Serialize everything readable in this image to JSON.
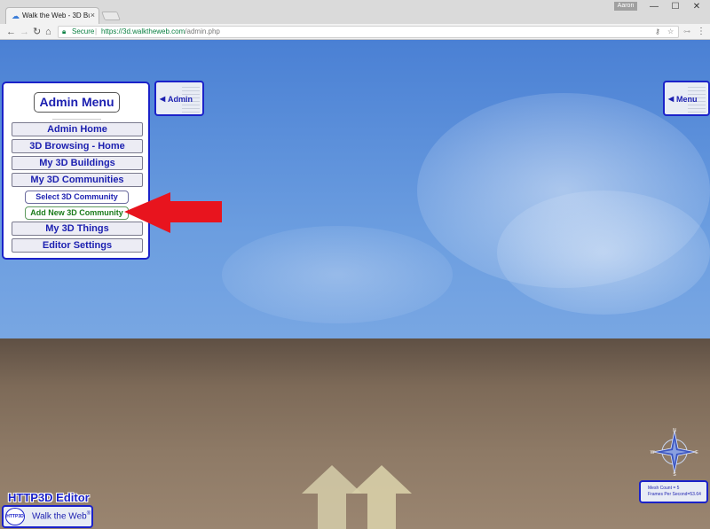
{
  "browser": {
    "tab_title": "Walk the Web - 3D Buildi",
    "tab_close": "×",
    "user_badge": "Aaron",
    "window": {
      "minimize": "—",
      "maximize": "☐",
      "close": "✕"
    },
    "nav": {
      "back": "←",
      "forward": "→",
      "reload": "↻",
      "home": "⌂"
    },
    "security_label": "Secure",
    "separator": "|",
    "url_scheme": "https://",
    "url_host": "3d.walktheweb.com",
    "url_path": "/admin.php",
    "omnibox_icons": [
      "key-icon",
      "star-icon",
      "extension-icon"
    ],
    "menu_icon": "⋮"
  },
  "scene": {
    "sky_color": "#6c9ee0",
    "ground_color": "#8e7a66",
    "accent_color": "#1b22c9"
  },
  "left_toggle": {
    "label": "Admin",
    "arrow": "◀"
  },
  "right_toggle": {
    "label": "Menu",
    "arrow": "◀"
  },
  "admin_menu": {
    "title": "Admin Menu",
    "items": [
      {
        "label": "Admin Home"
      },
      {
        "label": "3D Browsing - Home"
      },
      {
        "label": "My 3D Buildings"
      },
      {
        "label": "My 3D Communities"
      },
      {
        "label": "Select 3D Community",
        "sub": true
      },
      {
        "label": "Add New 3D Community",
        "sub": true,
        "active": true
      },
      {
        "label": "My 3D Things"
      },
      {
        "label": "Editor Settings"
      }
    ]
  },
  "annotation": {
    "arrow_color": "#e8141e"
  },
  "editor_title": "HTTP3D Editor",
  "wtw_button": {
    "logo_text": "HTTP3D",
    "label": "Walk the Web",
    "registered": "®"
  },
  "compass": {
    "letters": [
      "N",
      "E",
      "S",
      "W"
    ]
  },
  "stats": {
    "mesh_count": "Mesh Count = 5",
    "fps": "Frames Per Second=53.64"
  }
}
